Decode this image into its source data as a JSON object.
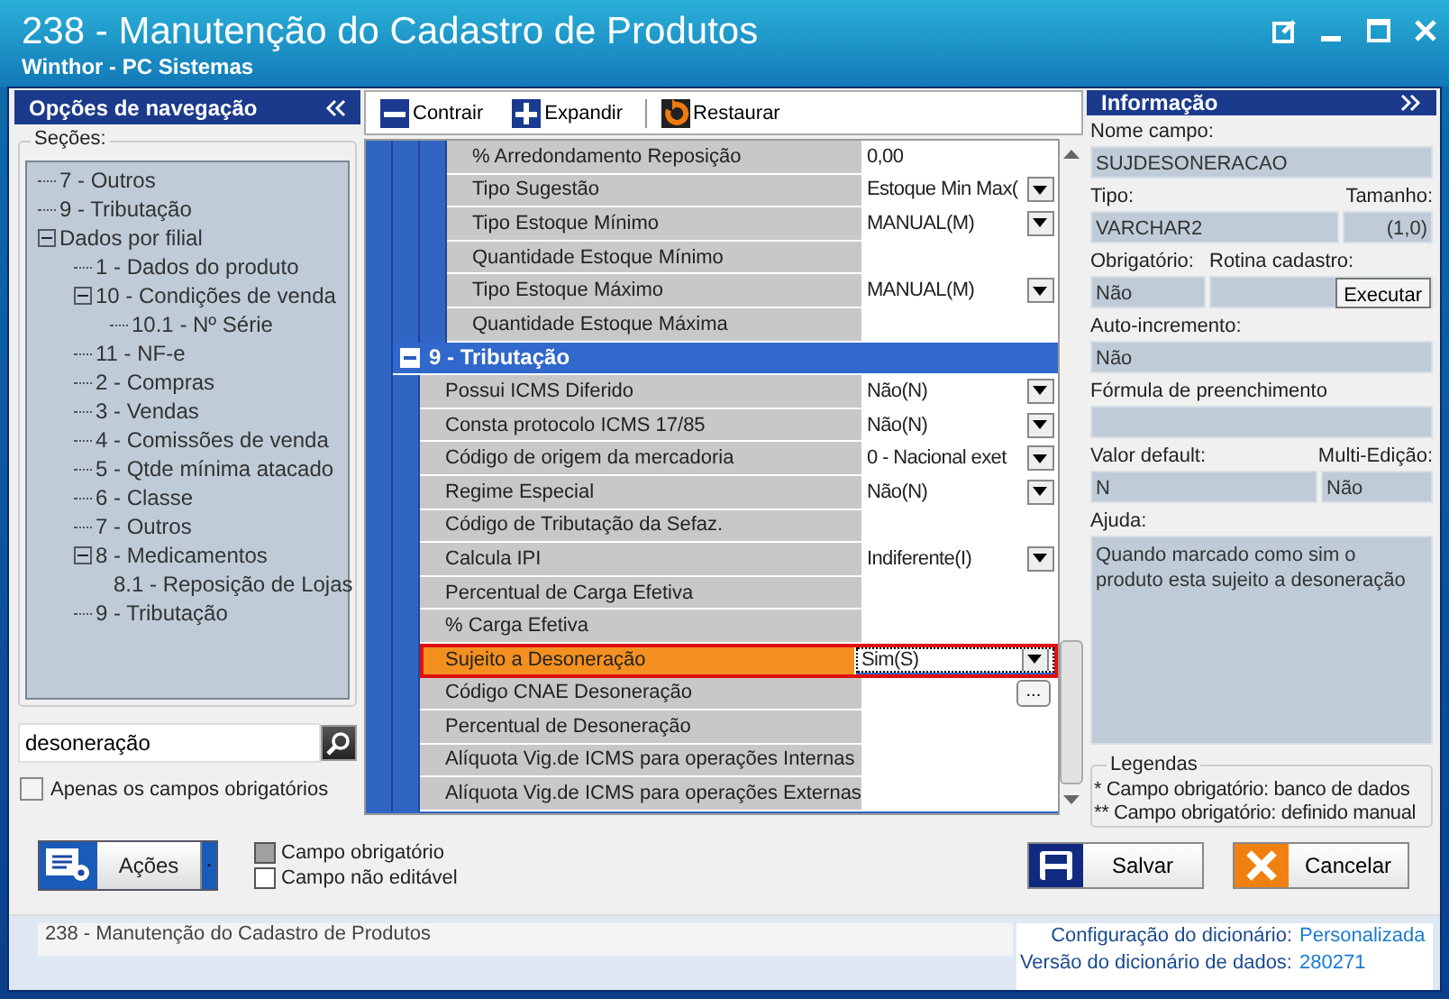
{
  "window": {
    "title": "238 - Manutenção do Cadastro de Produtos",
    "subtitle": "Winthor - PC Sistemas"
  },
  "navigation": {
    "title": "Opções de navegação",
    "sections_label": "Seções:",
    "tree": [
      {
        "label": "7 - Outros"
      },
      {
        "label": "9 - Tributação"
      },
      {
        "label": "Dados por filial",
        "expanded": true,
        "children": [
          {
            "label": "1 - Dados do produto"
          },
          {
            "label": "10 - Condições de venda",
            "expanded": true,
            "children": [
              {
                "label": "10.1 - Nº Série"
              }
            ]
          },
          {
            "label": "11 - NF-e"
          },
          {
            "label": "2 - Compras"
          },
          {
            "label": "3 - Vendas"
          },
          {
            "label": "4 - Comissões de venda"
          },
          {
            "label": "5 - Qtde mínima atacado"
          },
          {
            "label": "6 - Classe"
          },
          {
            "label": "7 - Outros"
          },
          {
            "label": "8 - Medicamentos",
            "expanded": true,
            "children": [
              {
                "label": "8.1 -  Reposição de Lojas"
              }
            ]
          },
          {
            "label": "9 - Tributação"
          }
        ]
      }
    ],
    "search": {
      "value": "desoneração"
    },
    "required_only": {
      "label": "Apenas os campos obrigatórios",
      "checked": false
    }
  },
  "toolbar": [
    {
      "label": "Contrair",
      "kind": "collapse"
    },
    {
      "label": "Expandir",
      "kind": "expand"
    },
    {
      "label": "Restaurar",
      "kind": "restore"
    }
  ],
  "grid": {
    "rows_above": [
      {
        "label": "% Arredondamento Reposição",
        "kind": "text",
        "value": "0,00",
        "selected": false
      },
      {
        "label": "Tipo Sugestão",
        "kind": "select",
        "value": "Estoque Min Max(",
        "selected": false
      },
      {
        "label": "Tipo Estoque Mínimo",
        "kind": "select",
        "value": "MANUAL(M)",
        "selected": false
      },
      {
        "label": "Quantidade Estoque Mínimo",
        "kind": "empty",
        "selected": false
      },
      {
        "label": "Tipo Estoque Máximo",
        "kind": "select",
        "value": "MANUAL(M)",
        "selected": false
      },
      {
        "label": "Quantidade Estoque Máxima",
        "kind": "empty",
        "selected": false
      }
    ],
    "sections": [
      {
        "title": "9 - Tributação",
        "expanded": true,
        "rows": [
          {
            "label": "Possui ICMS Diferido",
            "kind": "select",
            "value": "Não(N)",
            "selected": false
          },
          {
            "label": "Consta protocolo ICMS 17/85",
            "kind": "select",
            "value": "Não(N)",
            "selected": false
          },
          {
            "label": "Código de origem da mercadoria",
            "kind": "select",
            "value": "0 - Nacional exet",
            "selected": false
          },
          {
            "label": "Regime Especial",
            "kind": "select",
            "value": "Não(N)",
            "selected": false
          },
          {
            "label": "Código de Tributação da Sefaz.",
            "kind": "empty",
            "selected": false
          },
          {
            "label": "Calcula IPI",
            "kind": "select",
            "value": "Indiferente(I)",
            "selected": false
          },
          {
            "label": "Percentual de Carga Efetiva",
            "kind": "empty",
            "selected": false
          },
          {
            "label": "%  Carga Efetiva",
            "kind": "empty",
            "selected": false
          },
          {
            "label": "Sujeito a Desoneração",
            "kind": "select",
            "value": "Sim(S)",
            "selected": true
          },
          {
            "label": "Código CNAE Desoneração",
            "kind": "ellipsis",
            "button": "...",
            "selected": false
          },
          {
            "label": "Percentual de Desoneração",
            "kind": "empty",
            "selected": false
          },
          {
            "label": "Alíquota Vig.de ICMS para operações Internas",
            "kind": "empty",
            "selected": false
          },
          {
            "label": "Alíquota Vig.de ICMS para operações Externas",
            "kind": "empty",
            "selected": false
          }
        ]
      }
    ]
  },
  "info": {
    "title": "Informação",
    "field_name": {
      "label": "Nome campo:",
      "value": "SUJDESONERACAO"
    },
    "type": {
      "label": "Tipo:",
      "value": "VARCHAR2"
    },
    "size": {
      "label": "Tamanho:",
      "value": "(1,0)"
    },
    "required": {
      "label": "Obrigatório:",
      "value": "Não"
    },
    "routine": {
      "label": "Rotina cadastro:",
      "button": "Executar"
    },
    "auto_increment": {
      "label": "Auto-incremento:",
      "value": "Não"
    },
    "formula": {
      "label": "Fórmula de preenchimento"
    },
    "default": {
      "label": "Valor default:",
      "value": "N"
    },
    "multi_edit": {
      "label": "Multi-Edição:",
      "value": "Não"
    },
    "help": {
      "label": "Ajuda:",
      "value": "Quando marcado como sim o produto esta sujeito a desoneração"
    },
    "legend": {
      "title": "Legendas",
      "lines": [
        "* Campo obrigatório: banco de dados",
        "** Campo obrigatório: definido manual"
      ]
    }
  },
  "footer": {
    "actions": "Ações",
    "legend": [
      {
        "label": "Campo obrigatório",
        "color": "#a0a0a0"
      },
      {
        "label": "Campo não editável",
        "color": "#ffffff"
      }
    ],
    "save": "Salvar",
    "cancel": "Cancelar"
  },
  "status_bar": {
    "text": "238 - Manutenção do Cadastro de Produtos",
    "items": [
      {
        "label": "Configuração do dicionário:",
        "value": "Personalizada"
      },
      {
        "label": "Versão do dicionário de dados:",
        "value": "280271"
      }
    ]
  }
}
